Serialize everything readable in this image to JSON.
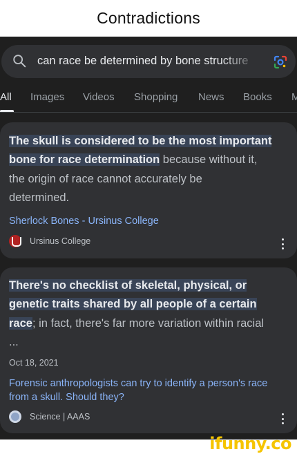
{
  "meme": {
    "title": "Contradictions",
    "watermark": "ifunny.co"
  },
  "search": {
    "query": "can race be determined by bone structure",
    "icons": [
      "search-icon",
      "google-lens-icon"
    ]
  },
  "tabs": [
    {
      "label": "All",
      "active": true
    },
    {
      "label": "Images"
    },
    {
      "label": "Videos"
    },
    {
      "label": "Shopping"
    },
    {
      "label": "News"
    },
    {
      "label": "Books"
    },
    {
      "label": "M"
    }
  ],
  "results": [
    {
      "snippet_highlight_1": "The skull is considered to be the most important",
      "snippet_highlight_2": "bone for race determination",
      "snippet_rest_1": " because without it,",
      "snippet_rest_2": "the origin of race cannot accurately be",
      "snippet_rest_3": "determined.",
      "title": "Sherlock Bones - Ursinus College",
      "source": "Ursinus College",
      "favicon": "ursinus-logo-icon"
    },
    {
      "snippet_highlight_1": "There's no checklist of skeletal, physical, or",
      "snippet_highlight_2": "genetic traits shared by all people of a certain",
      "snippet_highlight_3": "race",
      "snippet_rest_1": "; in fact, there's far more variation within racial",
      "snippet_ellipsis": "...",
      "date": "Oct 18, 2021",
      "title": "Forensic anthropologists can try to identify a person's race from a skull. Should they?",
      "source": "Science | AAAS",
      "favicon": "aaas-logo-icon"
    }
  ],
  "colors": {
    "background": "#1f1f1f",
    "card": "#303134",
    "link": "#8ab4f8",
    "highlight": "#394457",
    "watermark": "#f5c400"
  }
}
